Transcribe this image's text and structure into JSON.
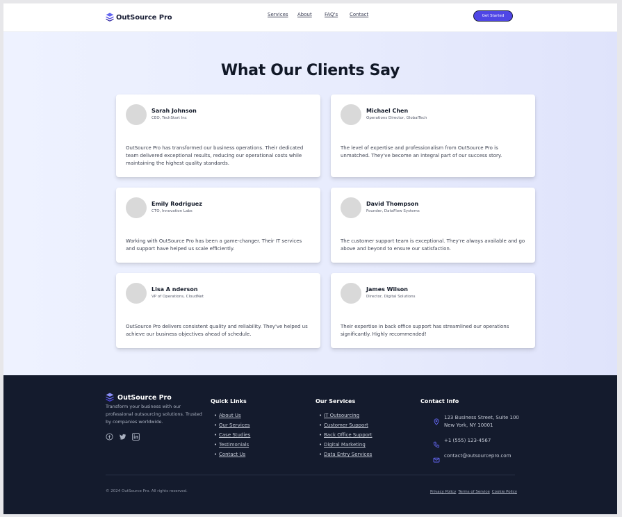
{
  "header": {
    "brand": "OutSource Pro",
    "nav": [
      "Services",
      "About",
      "FAQ's",
      "Contact"
    ],
    "cta_label": "Get Started"
  },
  "testimonials": {
    "title": "What Our Clients Say",
    "items": [
      {
        "name": "Sarah Johnson",
        "role": "CEO, TechStart Inc",
        "quote": "OutSource Pro has transformed our business operations. Their dedicated team delivered exceptional results, reducing our operational costs while maintaining the highest quality standards."
      },
      {
        "name": "Michael Chen",
        "role": "Operations Director, GlobalTech",
        "quote": "The level of expertise and professionalism from OutSource Pro is unmatched. They've become an integral part of our success story."
      },
      {
        "name": "Emily Rodriguez",
        "role": "CTO, Innovation Labs",
        "quote": "Working with OutSource Pro has been a game-changer. Their IT services and support have helped us scale efficiently."
      },
      {
        "name": "David Thompson",
        "role": "Founder, DataFlow Systems",
        "quote": "The customer support team is exceptional. They're always available and go above and beyond to ensure our satisfaction."
      },
      {
        "name": "Lisa A nderson",
        "role": "VP of Operations, CloudNet",
        "quote": "OutSource Pro delivers consistent quality and reliability. They've helped us achieve our business objectives ahead of schedule."
      },
      {
        "name": "James Wilson",
        "role": "Director, Digital Solutions",
        "quote": "Their expertise in back office support has streamlined our operations significantly. Highly recommended!"
      }
    ]
  },
  "footer": {
    "brand": "OutSource Pro",
    "description": "Transform your business with our professional outsourcing solutions. Trusted by companies worldwide.",
    "social_icons": [
      "facebook-icon",
      "twitter-icon",
      "linkedin-icon"
    ],
    "quick_links": {
      "title": "Quick Links",
      "items": [
        "About Us",
        "Our Services",
        "Case Studies",
        "Testimonials",
        "Contact Us"
      ]
    },
    "services": {
      "title": "Our Services",
      "items": [
        "IT Outsourcing",
        "Customer Support",
        "Back Office Support",
        "Digital Marketing",
        "Data Entry Services"
      ]
    },
    "contact": {
      "title": "Contact Info",
      "address_line1": "123 Business Street, Suite 100",
      "address_line2": "New York, NY 10001",
      "phone": "+1 (555) 123-4567",
      "email": "contact@outsourcepro.com"
    },
    "copyright": "© 2024 OutSource Pro. All rights reserved.",
    "legal": [
      "Privacy Policy",
      "Terms of Service",
      "Cookie Policy"
    ]
  },
  "colors": {
    "accent": "#4f46e5",
    "footer_bg": "#141b2d",
    "logo_top": "#6366f1",
    "logo_mid": "#4f46e5",
    "logo_bottom": "#3730a3"
  }
}
